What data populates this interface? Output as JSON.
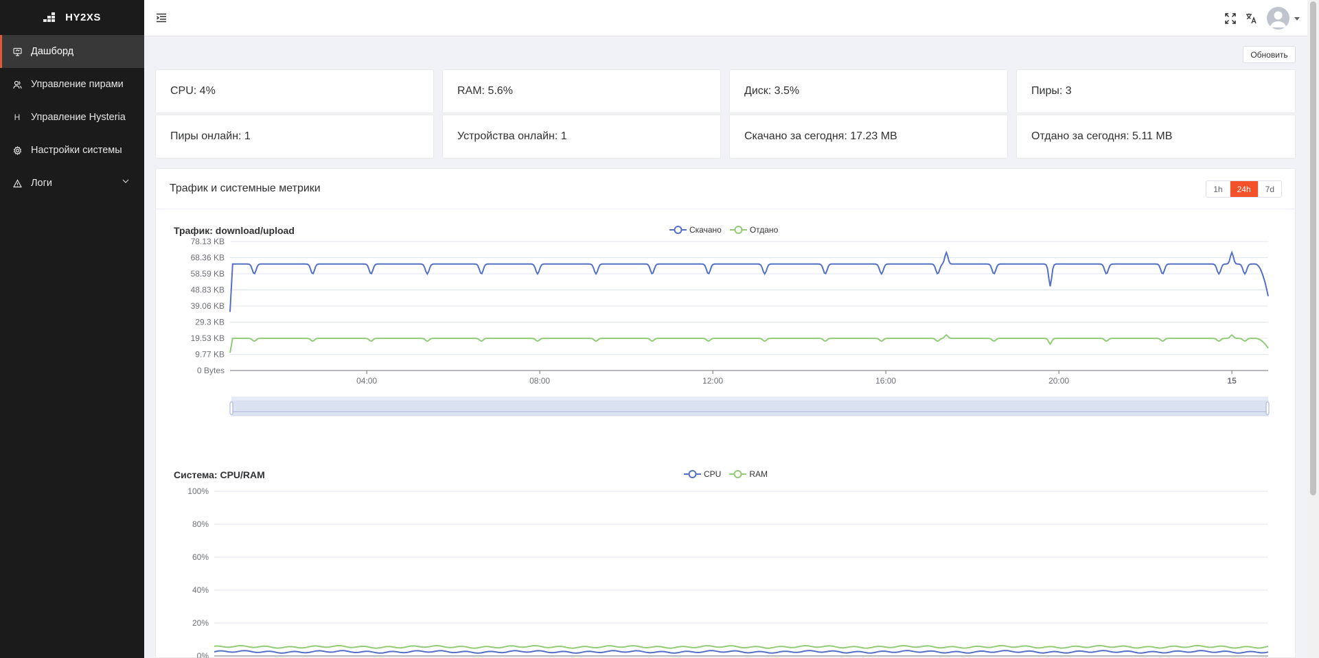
{
  "app": {
    "name": "HY2XS"
  },
  "sidebar": {
    "items": [
      {
        "label": "Дашборд",
        "icon": "dashboard-icon"
      },
      {
        "label": "Управление пирами",
        "icon": "users-icon"
      },
      {
        "label": "Управление Hysteria",
        "icon": "letter-h-icon",
        "glyph": "H"
      },
      {
        "label": "Настройки системы",
        "icon": "gear-icon"
      },
      {
        "label": "Логи",
        "icon": "warning-icon"
      }
    ]
  },
  "header": {
    "refresh_label": "Обновить"
  },
  "stats": [
    "CPU: 4%",
    "RAM: 5.6%",
    "Диск: 3.5%",
    "Пиры: 3",
    "Пиры онлайн: 1",
    "Устройства онлайн: 1",
    "Скачано за сегодня: 17.23 MB",
    "Отдано за сегодня: 5.11 MB"
  ],
  "panel": {
    "title": "Трафик и системные метрики",
    "ranges": [
      "1h",
      "24h",
      "7d"
    ],
    "active_range": "24h"
  },
  "colors": {
    "download": "#5470c6",
    "upload": "#91cc75",
    "accent": "#f4502a",
    "sidebar_bg": "#1b1b1b"
  },
  "chart_data": [
    {
      "type": "line",
      "title": "Трафик: download/upload",
      "series": [
        {
          "name": "Скачано"
        },
        {
          "name": "Отдано"
        }
      ],
      "y_ticks": [
        "0 Bytes",
        "9.77 KB",
        "19.53 KB",
        "29.3 KB",
        "39.06 KB",
        "48.83 KB",
        "58.59 KB",
        "68.36 KB",
        "78.13 KB"
      ],
      "y_range_kb": [
        0,
        78.13
      ],
      "x_ticks": [
        "04:00",
        "08:00",
        "12:00",
        "16:00",
        "20:00",
        "15"
      ],
      "x_range_hours": [
        0.84,
        24.84
      ],
      "x_tick_hours": [
        4,
        8,
        12,
        16,
        20,
        24
      ],
      "download_baseline_kb": 64.5,
      "download_dip_kb": 58.5,
      "download_dip_hours": [
        1.4,
        2.75,
        4.1,
        5.4,
        6.65,
        7.95,
        9.3,
        10.6,
        11.9,
        13.2,
        14.6,
        15.9,
        17.2,
        18.5,
        19.8,
        21.1,
        22.4,
        23.7,
        24.3
      ],
      "download_spike_hours": [
        17.4,
        24.0
      ],
      "download_spike_kb": 71.5,
      "download_deep_dip": {
        "hour": 19.8,
        "kb": 51
      },
      "download_end_kb": 45,
      "upload_baseline_kb": 19.5,
      "upload_dip_kb": 17.8,
      "upload_spike_kb": 21.5,
      "upload_end_kb": 13.5,
      "grid": true,
      "legend": "top-center",
      "has_zoom_slider": true
    },
    {
      "type": "line",
      "title": "Система: CPU/RAM",
      "series": [
        {
          "name": "CPU",
          "approx_percent": 2.5
        },
        {
          "name": "RAM",
          "approx_percent": 5.5
        }
      ],
      "y_ticks": [
        "0%",
        "20%",
        "40%",
        "60%",
        "80%",
        "100%"
      ],
      "y_range": [
        0,
        100
      ],
      "grid": true,
      "legend": "top-center"
    }
  ]
}
